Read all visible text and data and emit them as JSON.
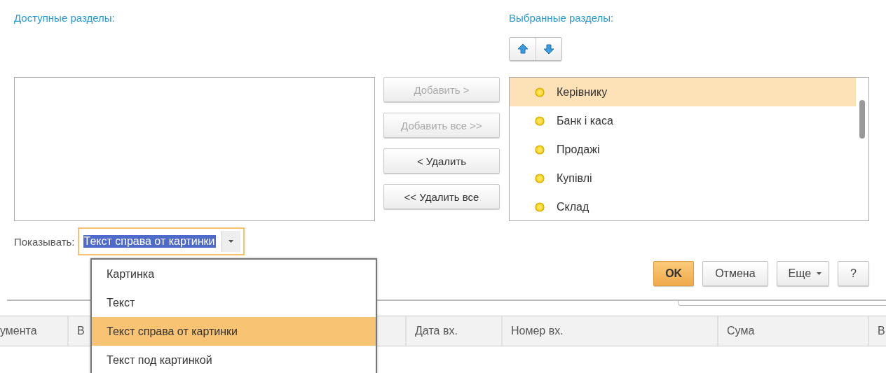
{
  "available_sections": {
    "label": "Доступные разделы:"
  },
  "selected_sections": {
    "label": "Выбранные разделы:",
    "items": [
      {
        "label": "Керівнику",
        "selected": true
      },
      {
        "label": "Банк і каса",
        "selected": false
      },
      {
        "label": "Продажі",
        "selected": false
      },
      {
        "label": "Купівлі",
        "selected": false
      },
      {
        "label": "Склад",
        "selected": false
      }
    ]
  },
  "transfer_buttons": [
    {
      "label": "Добавить >",
      "disabled": true
    },
    {
      "label": "Добавить все >>",
      "disabled": true
    },
    {
      "label": "< Удалить",
      "disabled": false
    },
    {
      "label": "<< Удалить все",
      "disabled": false
    }
  ],
  "show": {
    "label": "Показывать:",
    "value": "Текст справа от картинки",
    "expanded": true,
    "options": [
      {
        "label": "Картинка",
        "selected": false
      },
      {
        "label": "Текст",
        "selected": false
      },
      {
        "label": "Текст справа от картинки",
        "selected": true
      },
      {
        "label": "Текст под картинкой",
        "selected": false
      }
    ]
  },
  "dialog_buttons": [
    {
      "label": "OK",
      "kind": "default"
    },
    {
      "label": "Отмена",
      "kind": "plain"
    },
    {
      "label": "Еще",
      "kind": "menu"
    },
    {
      "label": "?",
      "kind": "plain"
    }
  ],
  "table": {
    "columns": [
      "умента",
      "В",
      "Дата вх.",
      "Номер вх.",
      "Сума",
      "В"
    ]
  }
}
